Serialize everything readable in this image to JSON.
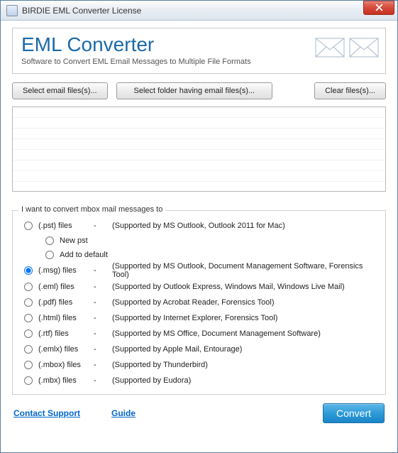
{
  "window": {
    "title": "BIRDIE EML Converter License"
  },
  "header": {
    "title": "EML Converter",
    "subtitle": "Software to Convert EML Email Messages to Multiple File Formats"
  },
  "buttons": {
    "select_files": "Select email files(s)...",
    "select_folder": "Select folder having email files(s)...",
    "clear_files": "Clear files(s)..."
  },
  "group_legend": "I want to convert mbox mail messages to",
  "options": [
    {
      "label": "(.pst) files",
      "desc": "(Supported by MS Outlook, Outlook 2011 for Mac)",
      "selected": false,
      "sub": [
        {
          "label": "New pst"
        },
        {
          "label": "Add to default"
        }
      ]
    },
    {
      "label": "(.msg) files",
      "desc": "(Supported by MS Outlook, Document Management Software, Forensics Tool)",
      "selected": true
    },
    {
      "label": "(.eml) files",
      "desc": "(Supported by Outlook Express,  Windows Mail, Windows Live Mail)",
      "selected": false
    },
    {
      "label": "(.pdf) files",
      "desc": "(Supported by Acrobat Reader, Forensics Tool)",
      "selected": false
    },
    {
      "label": "(.html) files",
      "desc": "(Supported by Internet Explorer, Forensics Tool)",
      "selected": false
    },
    {
      "label": "(.rtf) files",
      "desc": "(Supported by MS Office, Document Management Software)",
      "selected": false
    },
    {
      "label": "(.emlx) files",
      "desc": "(Supported by Apple Mail, Entourage)",
      "selected": false
    },
    {
      "label": "(.mbox) files",
      "desc": "(Supported by Thunderbird)",
      "selected": false
    },
    {
      "label": "(.mbx) files",
      "desc": "(Supported by Eudora)",
      "selected": false
    }
  ],
  "footer": {
    "support": "Contact Support",
    "guide": "Guide",
    "convert": "Convert"
  }
}
